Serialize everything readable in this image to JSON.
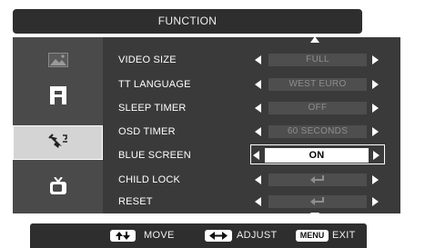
{
  "header": {
    "title": "FUNCTION"
  },
  "sidebar": {
    "items": [
      {
        "name": "picture",
        "icon": "picture-icon"
      },
      {
        "name": "display",
        "icon": "monitor-stand-icon"
      },
      {
        "name": "setup",
        "icon": "tools-icon",
        "active": true
      },
      {
        "name": "tv",
        "icon": "tv-icon"
      }
    ]
  },
  "menu": {
    "rows": [
      {
        "label": "VIDEO SIZE",
        "value": "FULL"
      },
      {
        "label": "TT LANGUAGE",
        "value": "WEST EURO"
      },
      {
        "label": "SLEEP TIMER",
        "value": "OFF"
      },
      {
        "label": "OSD TIMER",
        "value": "60 SECONDS"
      },
      {
        "label": "BLUE SCREEN",
        "value": "ON",
        "selected": true
      },
      {
        "label": "CHILD LOCK",
        "value_icon": "enter-icon"
      },
      {
        "label": "RESET",
        "value_icon": "enter-icon"
      }
    ]
  },
  "footer": {
    "move_label": "MOVE",
    "adjust_label": "ADJUST",
    "menu_key": "MENU",
    "exit_label": "EXIT"
  },
  "colors": {
    "title_bg": "#2e2e2e",
    "sidebar_bg": "#4a4a4a",
    "panel_bg": "#3a3a3a",
    "value_box_bg": "#4e4e4e",
    "value_text": "#8e8e8e",
    "selected_bg": "#ffffff"
  }
}
